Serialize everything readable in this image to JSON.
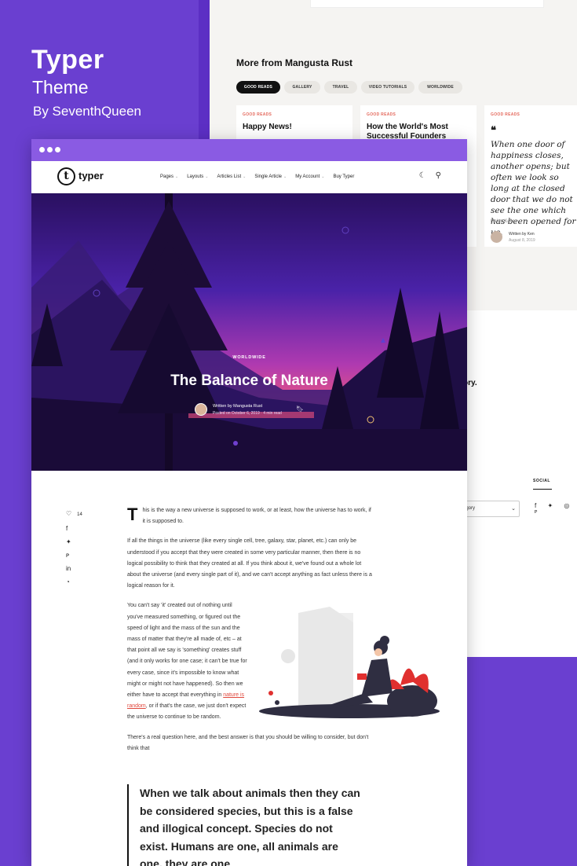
{
  "brand": {
    "title": "Typer",
    "subtitle": "Theme",
    "author": "By SeventhQueen"
  },
  "background_page": {
    "section_title": "More from Mangusta Rust",
    "tabs": [
      "GOOD READS",
      "GALLERY",
      "TRAVEL",
      "VIDEO TUTORIALS",
      "WORLDWIDE"
    ],
    "cards": [
      {
        "category": "GOOD READS",
        "title": "Happy News!"
      },
      {
        "category": "GOOD READS",
        "title": "How the World's Most Successful Founders"
      },
      {
        "category": "GOOD READS",
        "quote": "When one door of happiness closes, another opens; but often we look so long at the closed door that we do not see the one which has been opened for us.",
        "quote_author": "Helen Keller",
        "written_by": "Written by Ken",
        "date": "August 8, 2019"
      }
    ],
    "fragment_text": "ory.",
    "social_label": "SOCIAL",
    "social_icons": "f ✦ ◎ ᴾ",
    "category_select": "egory"
  },
  "window": {
    "logo_letter": "t",
    "logo_text": "typer",
    "nav": [
      "Pages",
      "Layouts",
      "Articles List",
      "Single Article",
      "My Account",
      "Buy Typer"
    ],
    "icons": [
      "moon-icon",
      "search-icon"
    ]
  },
  "hero": {
    "category": "WORLDWIDE",
    "title": "The Balance of Nature",
    "author_line": "Written by Mangusta Rust",
    "meta_line": "Posted on October 6, 2019  ·  4 min read"
  },
  "share": {
    "likes": "14",
    "icons": [
      "heart-icon",
      "facebook-icon",
      "twitter-icon",
      "pinterest-icon",
      "linkedin-icon",
      "whatsapp-icon"
    ]
  },
  "article": {
    "dropcap": "T",
    "p1": "his is the way a new universe is supposed to work, or at least, how the universe has to work, if it is supposed to.",
    "p2": "If all the things in the universe (like every single cell, tree, galaxy, star, planet, etc.) can only be understood if you accept that they were created in some very particular manner, then there is no logical possibility to think that they created at all. If you think about it, we've found out a whole lot about the universe (and every single part of it), and we can't accept anything as fact unless there is a logical reason for it.",
    "p3_start": "You can't say 'it' created out of nothing until you've measured something, or figured out the speed of light and the mass of the sun and the mass of matter that they're all made of, etc – at that point all we say is 'something' creates stuff (and it only works for one case; it can't be true for every case, since it's impossible to know what might or might not have happened). So then we either have to accept that everything in",
    "p3_link": "nature is random",
    "p3_end": ", or if that's the case, we just don't expect the universe to continue to be random.",
    "p4": "There's a real question here, and the best answer is that you should be willing to consider, but don't think that",
    "pullquote": "When we talk about animals then they can be considered species, but this is a false and illogical concept. Species do not exist. Humans are one, all animals are one, they are one"
  }
}
